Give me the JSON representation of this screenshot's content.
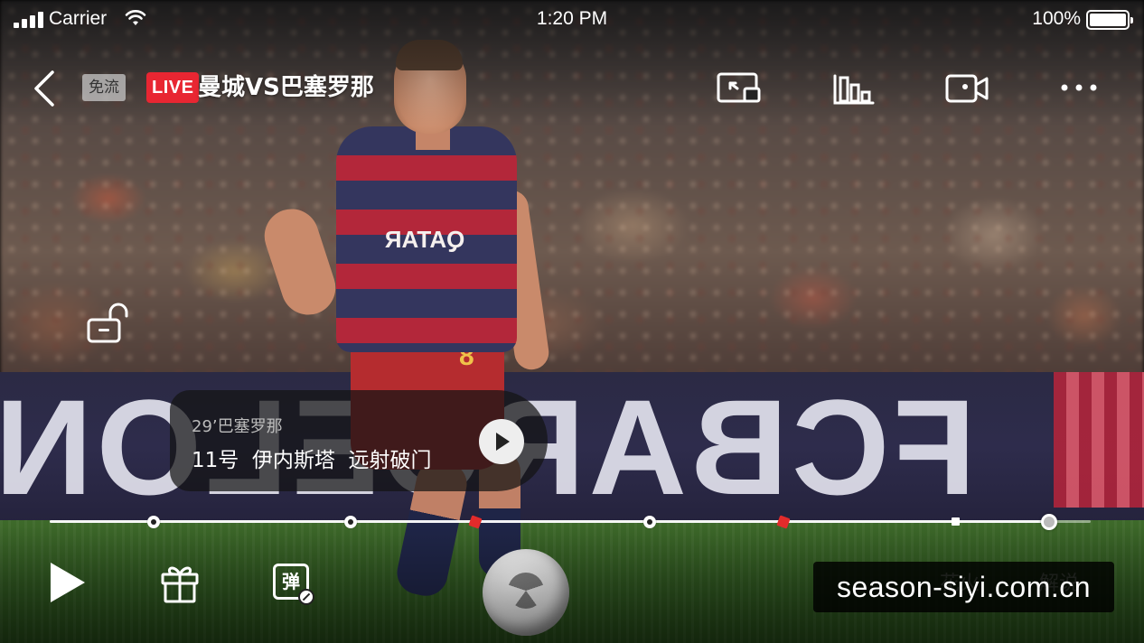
{
  "status_bar": {
    "carrier": "Carrier",
    "time": "1:20 PM",
    "battery": "100%"
  },
  "header": {
    "free_badge": "免流",
    "live_badge": "LIVE",
    "title": "曼城VS巴塞罗那",
    "icons": [
      "pip-icon",
      "stats-bar-icon",
      "camera-icon",
      "more-icon"
    ]
  },
  "highlight_card": {
    "time_team": "29’巴塞罗那",
    "description": "11号  伊内斯塔  远射破门"
  },
  "timeline": {
    "progress_fraction": 0.96,
    "markers": [
      {
        "type": "ball",
        "at": 0.1
      },
      {
        "type": "ball",
        "at": 0.289
      },
      {
        "type": "red-card",
        "at": 0.409
      },
      {
        "type": "ball",
        "at": 0.576
      },
      {
        "type": "red-card",
        "at": 0.705
      },
      {
        "type": "white-square",
        "at": 0.87
      }
    ]
  },
  "controls": {
    "danmaku_glyph": "弹"
  },
  "right_options": {
    "highlights": "花火",
    "commentary": "解说"
  },
  "watermark": "season-siyi.com.cn",
  "colors": {
    "live_red": "#e82632",
    "card_red": "#e32b2b",
    "overlay_dark": "rgba(20,20,20,0.72)"
  }
}
